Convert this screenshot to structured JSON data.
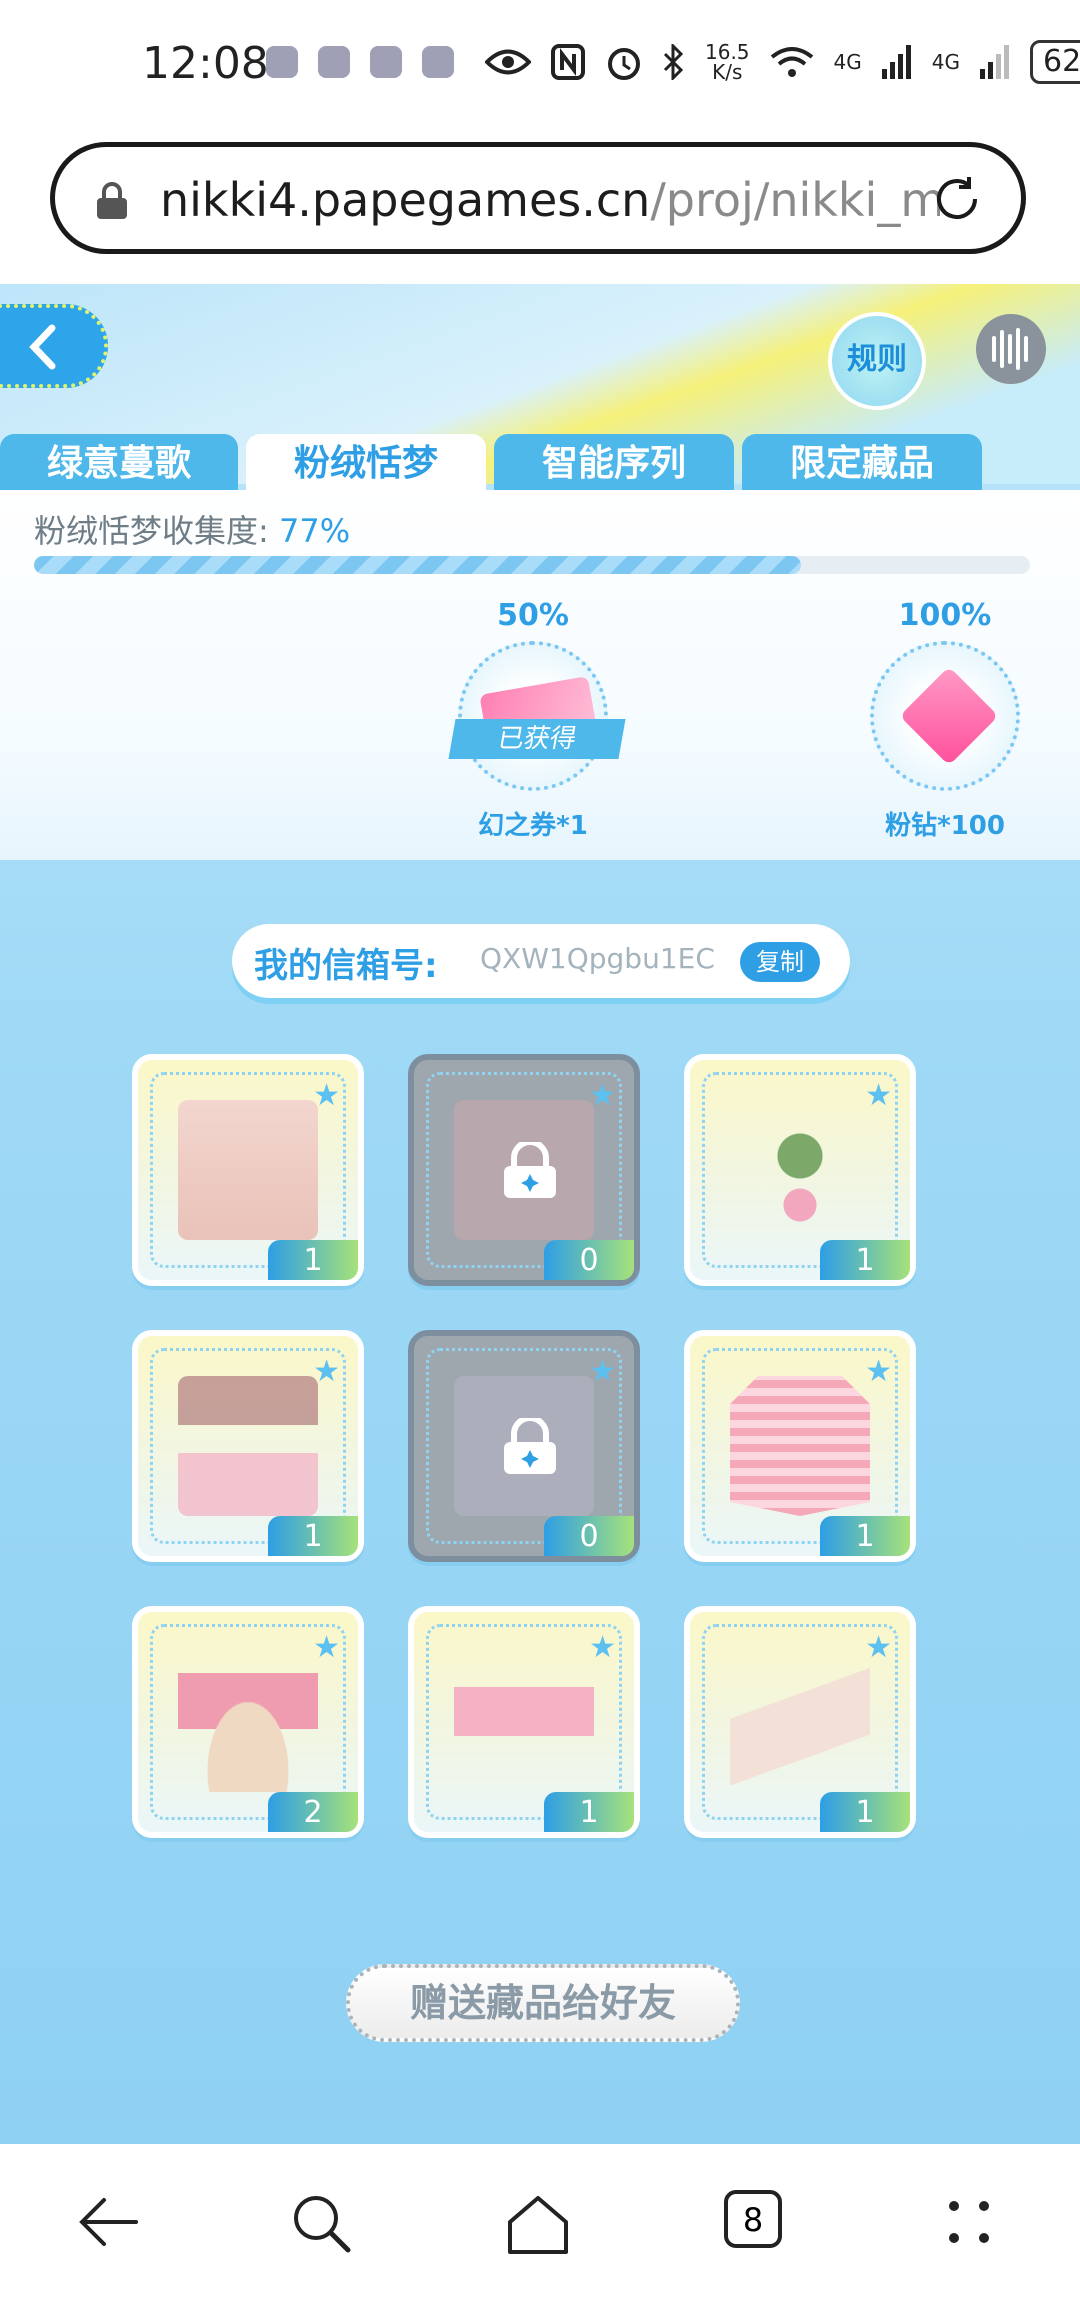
{
  "status_bar": {
    "time": "12:08",
    "speed_top": "16.5",
    "speed_bottom": "K/s",
    "signal1": "4G",
    "signal2": "4G",
    "battery": "62"
  },
  "browser": {
    "url_host": "nikki4.papegames.cn",
    "url_path": "/proj/nikki_m",
    "tab_count": "8"
  },
  "game": {
    "rules_label": "规则",
    "tabs": [
      {
        "label": "绿意蔓歌"
      },
      {
        "label": "粉绒恬梦"
      },
      {
        "label": "智能序列"
      },
      {
        "label": "限定藏品"
      }
    ],
    "collection_label": "粉绒恬梦收集度:",
    "collection_pct": "77%",
    "collection_fraction": 0.77,
    "milestones": [
      {
        "pct": "50%",
        "reward": "幻之券*1",
        "status": "已获得",
        "icon": "ticket-icon"
      },
      {
        "pct": "100%",
        "reward": "粉钻*100",
        "icon": "diamond-icon"
      }
    ],
    "mailbox_label": "我的信箱号:",
    "mailbox_code": "QXW1Qpgbu1EC",
    "copy_label": "复制",
    "items": [
      {
        "count": "1",
        "locked": false
      },
      {
        "count": "0",
        "locked": true
      },
      {
        "count": "1",
        "locked": false
      },
      {
        "count": "1",
        "locked": false
      },
      {
        "count": "0",
        "locked": true
      },
      {
        "count": "1",
        "locked": false
      },
      {
        "count": "2",
        "locked": false
      },
      {
        "count": "1",
        "locked": false
      },
      {
        "count": "1",
        "locked": false
      }
    ],
    "gift_button_label": "赠送藏品给好友"
  },
  "colors": {
    "accent": "#2e9ee5",
    "tab_bg": "#4fb8ea",
    "locked": "#9ea7ad"
  }
}
